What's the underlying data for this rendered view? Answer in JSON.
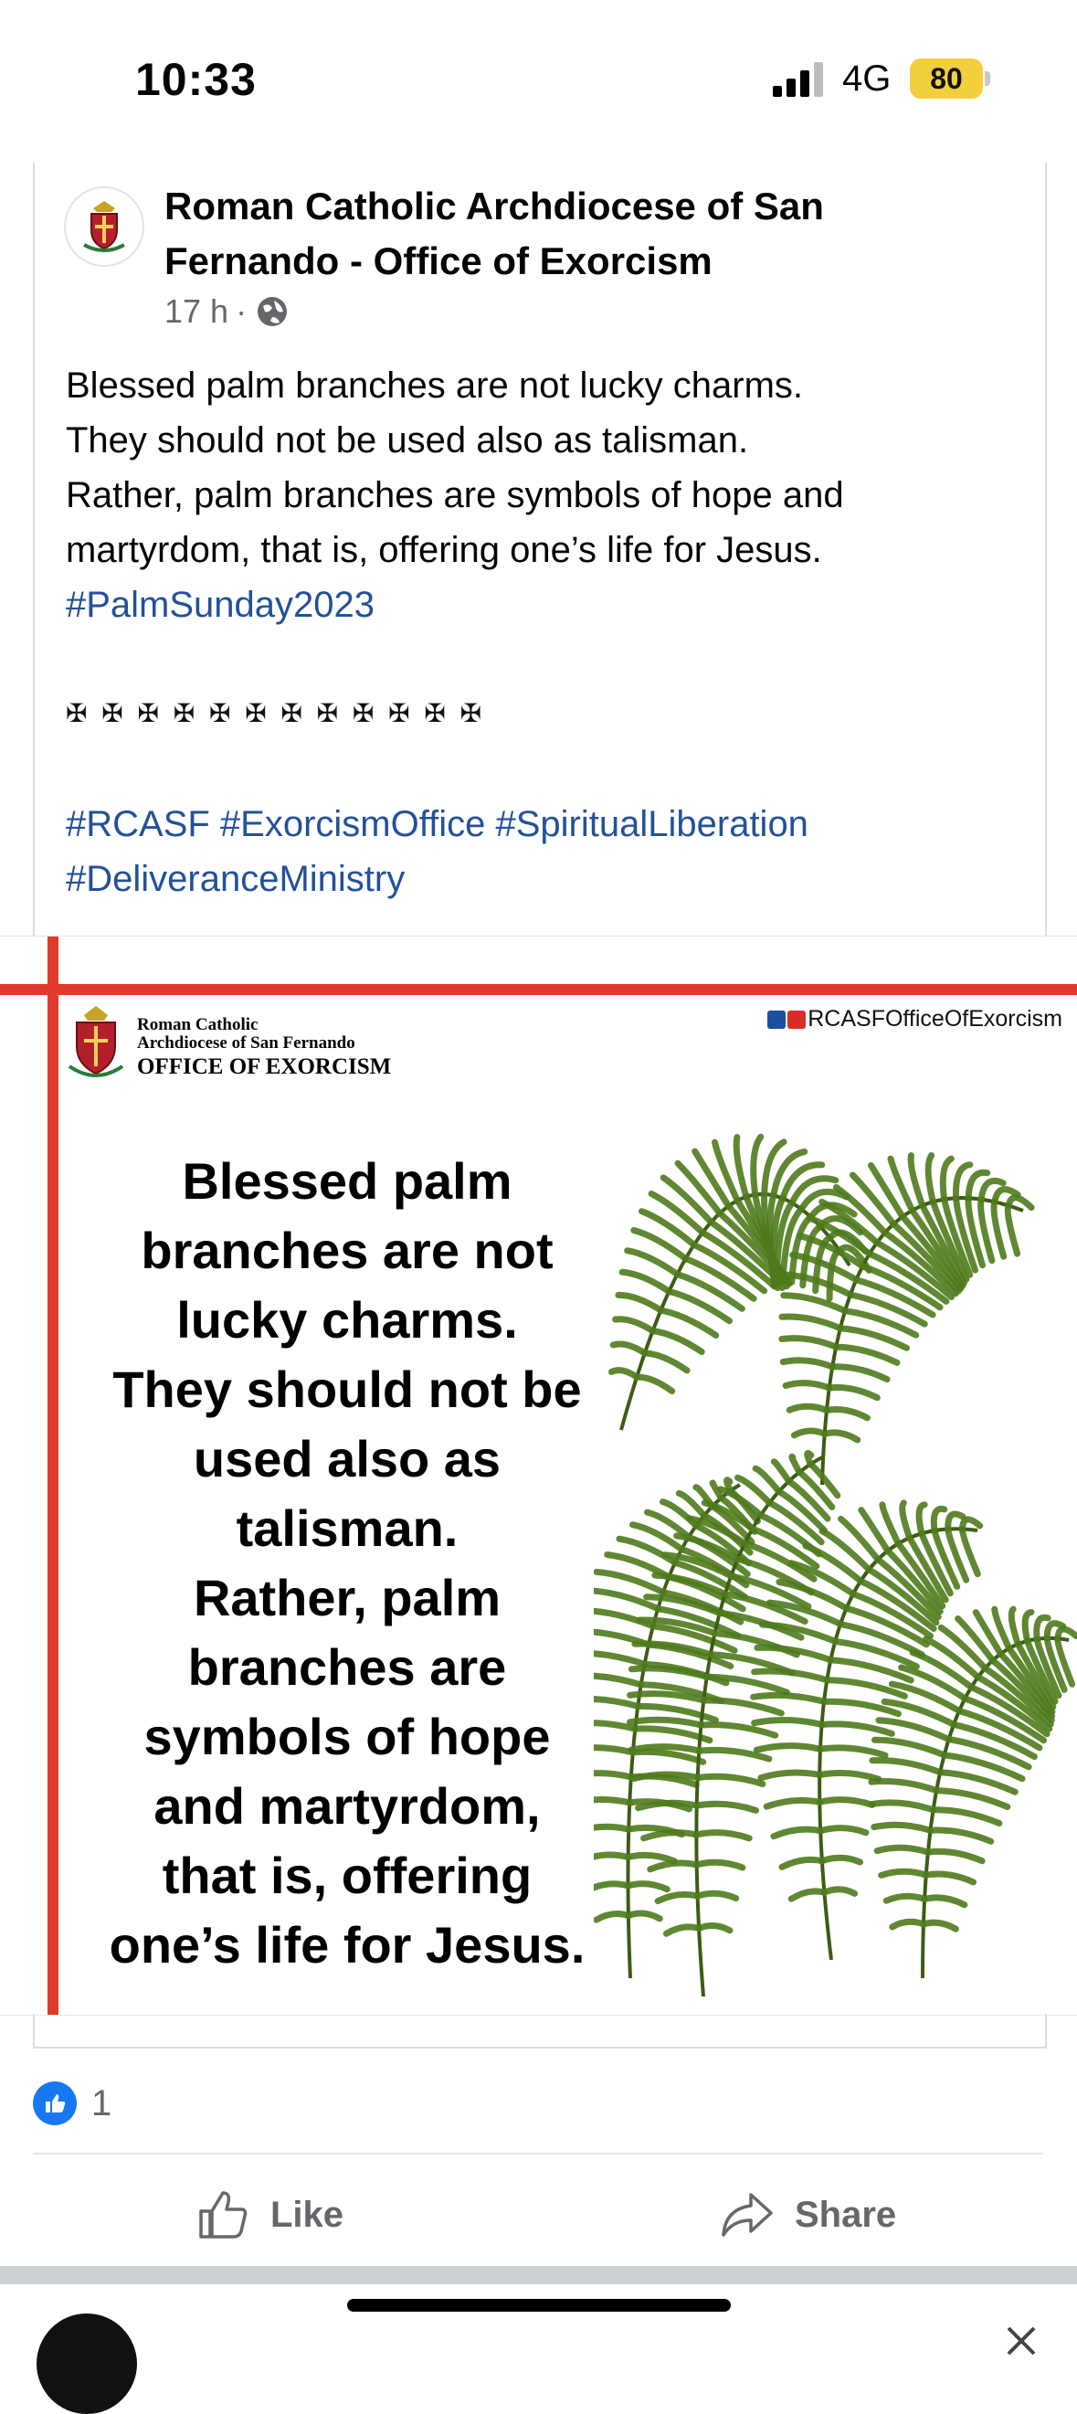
{
  "status_bar": {
    "time": "10:33",
    "network": "4G",
    "battery": "80"
  },
  "post": {
    "page_name": "Roman Catholic Archdiocese of San Fernando - Office of Exorcism",
    "time_ago": "17 h",
    "separator": "·",
    "audience_icon": "globe-icon",
    "text_lines": [
      "Blessed palm branches are not lucky charms.",
      "They should not be used also as talisman.",
      "Rather, palm branches are symbols of hope and",
      "martyrdom, that is, offering one’s life for Jesus."
    ],
    "hashtag1": "#PalmSunday2023",
    "crosses": "✠ ✠ ✠ ✠ ✠ ✠ ✠ ✠ ✠ ✠ ✠ ✠",
    "hashtags_line1": "#RCASF #ExorcismOffice #SpiritualLiberation",
    "hashtags_line2": "#DeliveranceMinistry"
  },
  "poster": {
    "org_line1": "Roman Catholic",
    "org_line2": "Archdiocese of San Fernando",
    "org_line3": "OFFICE OF EXORCISM",
    "handle": "RCASFOfficeOfExorcism",
    "message_lines": [
      "Blessed palm",
      "branches are not",
      "lucky charms.",
      "They should not be",
      "used also as",
      "talisman.",
      "Rather, palm",
      "branches are",
      "symbols of hope",
      "and martyrdom,",
      "that is, offering",
      "one’s life for Jesus."
    ],
    "accent_color": "#e23a2d",
    "palm_color": "#4f7a1c"
  },
  "reactions": {
    "count": "1"
  },
  "actions": {
    "like": "Like",
    "share": "Share"
  }
}
